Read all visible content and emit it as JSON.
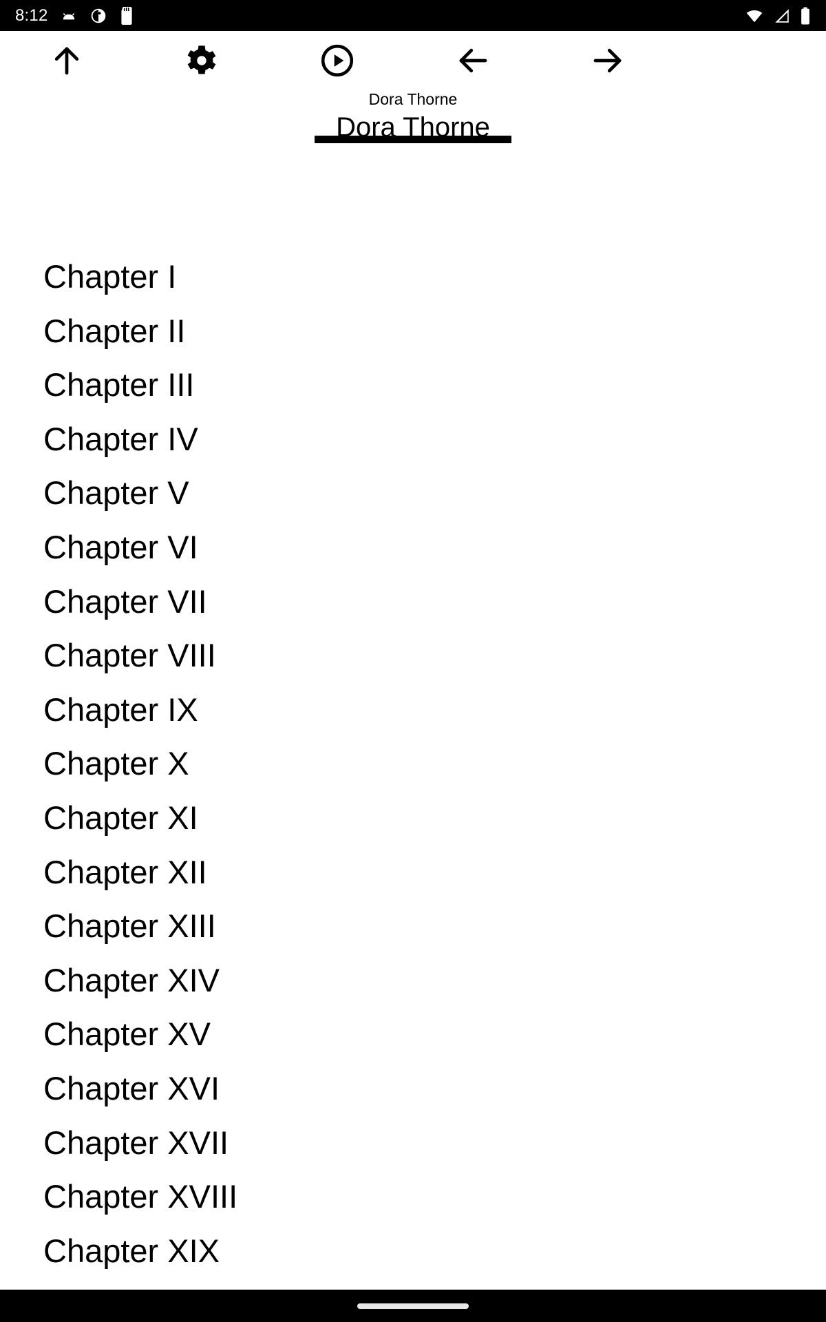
{
  "status_bar": {
    "time": "8:12",
    "left_icons": [
      "android-icon",
      "clock-circle-icon",
      "sd-card-icon"
    ],
    "right_icons": [
      "wifi-icon",
      "cellular-signal-icon",
      "battery-icon"
    ],
    "background_color": "#000000",
    "foreground_color": "#ffffff"
  },
  "toolbar": {
    "buttons": [
      {
        "name": "up-arrow-icon",
        "label": "Up"
      },
      {
        "name": "gear-icon",
        "label": "Settings"
      },
      {
        "name": "play-circle-icon",
        "label": "Play"
      },
      {
        "name": "arrow-left-icon",
        "label": "Previous"
      },
      {
        "name": "arrow-right-icon",
        "label": "Next"
      }
    ]
  },
  "book": {
    "subtitle": "Dora Thorne",
    "title": "Dora Thorne"
  },
  "chapters": [
    {
      "label": "Chapter I"
    },
    {
      "label": "Chapter II"
    },
    {
      "label": "Chapter III"
    },
    {
      "label": "Chapter IV"
    },
    {
      "label": "Chapter V"
    },
    {
      "label": "Chapter VI"
    },
    {
      "label": "Chapter VII"
    },
    {
      "label": "Chapter VIII"
    },
    {
      "label": "Chapter IX"
    },
    {
      "label": "Chapter X"
    },
    {
      "label": "Chapter XI"
    },
    {
      "label": "Chapter XII"
    },
    {
      "label": "Chapter XIII"
    },
    {
      "label": "Chapter XIV"
    },
    {
      "label": "Chapter XV"
    },
    {
      "label": "Chapter XVI"
    },
    {
      "label": "Chapter XVII"
    },
    {
      "label": "Chapter XVIII"
    },
    {
      "label": "Chapter XIX"
    }
  ],
  "nav_bar": {
    "gesture_pill": "home-gesture-pill",
    "background_color": "#000000",
    "pill_color": "#e8e8e8"
  },
  "theme": {
    "page_background": "#ffffff",
    "text_color": "#000000"
  }
}
